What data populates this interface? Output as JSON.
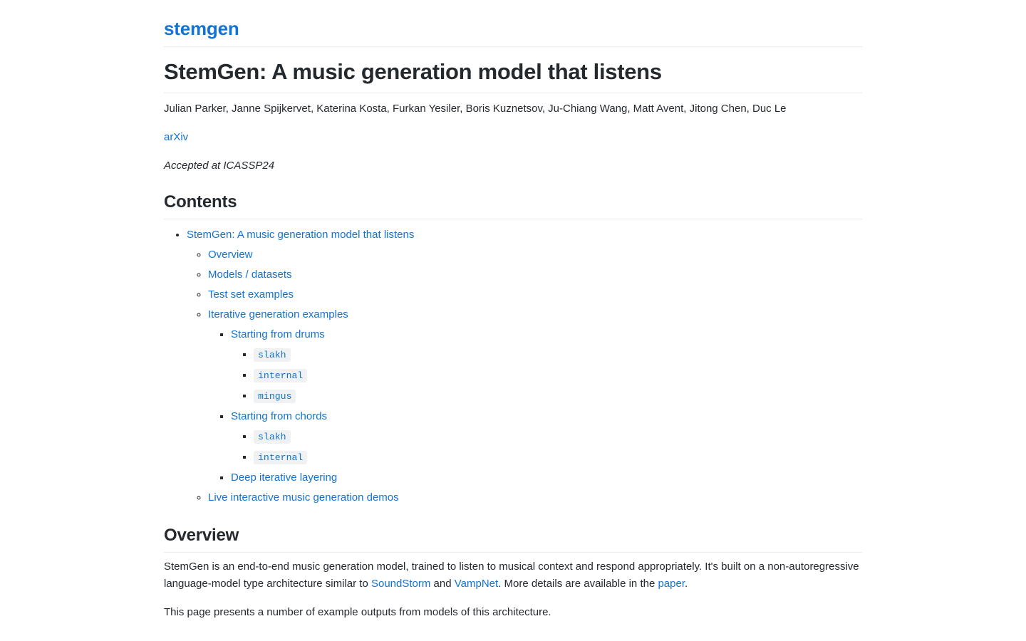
{
  "site": {
    "title": "stemgen"
  },
  "doc": {
    "title": "StemGen: A music generation model that listens",
    "authors": "Julian Parker, Janne Spijkervet, Katerina Kosta, Furkan Yesiler, Boris Kuznetsov, Ju-Chiang Wang, Matt Avent, Jitong Chen, Duc Le",
    "arxiv_link": "arXiv",
    "acceptance_note": "Accepted at ICASSP24"
  },
  "contents": {
    "heading": "Contents",
    "items": [
      {
        "label": "StemGen: A music generation model that listens",
        "children": [
          {
            "label": "Overview",
            "children": []
          },
          {
            "label": "Models / datasets",
            "children": []
          },
          {
            "label": "Test set examples",
            "children": []
          },
          {
            "label": "Iterative generation examples",
            "children": [
              {
                "label": "Starting from drums",
                "children": [
                  {
                    "label": "slakh",
                    "code": true
                  },
                  {
                    "label": "internal",
                    "code": true
                  },
                  {
                    "label": "mingus",
                    "code": true
                  }
                ]
              },
              {
                "label": "Starting from chords",
                "children": [
                  {
                    "label": "slakh",
                    "code": true
                  },
                  {
                    "label": "internal",
                    "code": true
                  }
                ]
              },
              {
                "label": "Deep iterative layering",
                "children": []
              }
            ]
          },
          {
            "label": "Live interactive music generation demos",
            "children": []
          }
        ]
      }
    ]
  },
  "overview": {
    "heading": "Overview",
    "paragraph1_part1": "StemGen is an end-to-end music generation model, trained to listen to musical context and respond appropriately. It's built on a non-autoregressive language-model type architecture similar to ",
    "link_soundstorm": "SoundStorm",
    "paragraph1_part2": " and ",
    "link_vampnet": "VampNet",
    "paragraph1_part3": ". More details are available in the ",
    "link_paper": "paper",
    "paragraph1_part4": ".",
    "paragraph2": "This page presents a number of example outputs from models of this architecture."
  },
  "colors": {
    "link": "#1273d4",
    "text": "#24292e",
    "rule": "#eaecef",
    "code_background": "#eff1f2"
  }
}
